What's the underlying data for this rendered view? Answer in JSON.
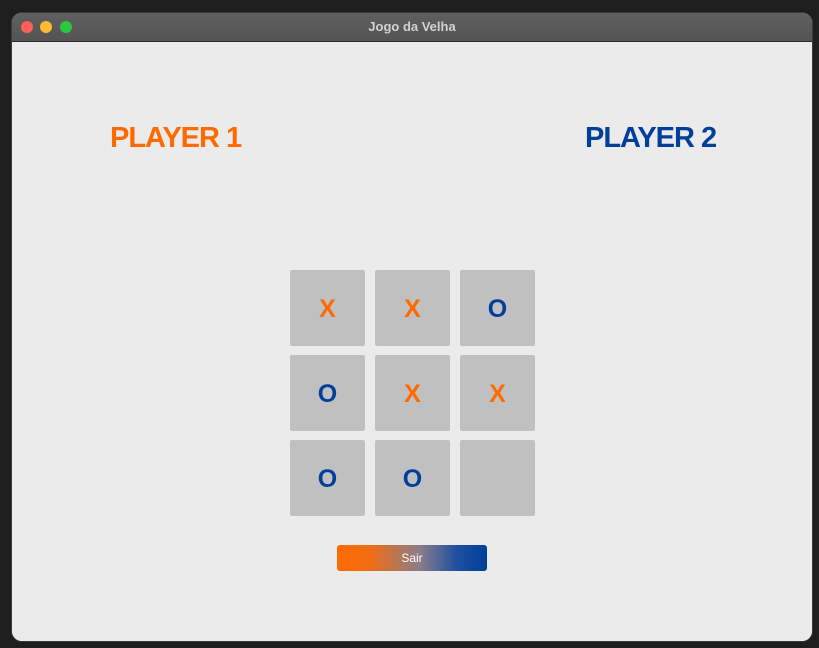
{
  "window": {
    "title": "Jogo da Velha"
  },
  "players": {
    "player1": "PLAYER 1",
    "player2": "PLAYER 2"
  },
  "board": {
    "cells": [
      "X",
      "X",
      "O",
      "O",
      "X",
      "X",
      "O",
      "O",
      ""
    ]
  },
  "exit_button": {
    "label": "Sair"
  },
  "colors": {
    "player1": "#ff6a00",
    "player2": "#003f9a",
    "cell_background": "#c0c0c0",
    "window_background": "#ebebeb"
  }
}
